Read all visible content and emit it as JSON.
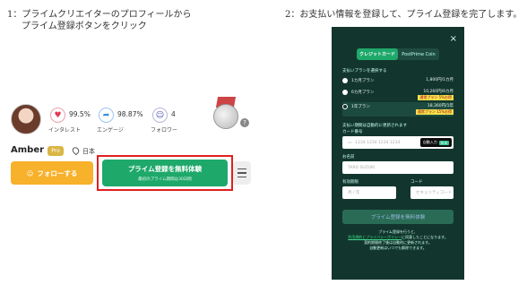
{
  "captions": {
    "step1_line1": "1：プライムクリエイターのプロフィールから",
    "step1_line2": "プライム登録ボタンをクリック",
    "step2": "2：お支払い情報を登録して、プライム登録を完了します。"
  },
  "profile": {
    "name": "Amber",
    "plan_badge": "Pro",
    "country": "日本",
    "stats": [
      {
        "icon": "heart-icon",
        "value": "99.5%",
        "label": "インタレスト"
      },
      {
        "icon": "share-icon",
        "value": "98.87%",
        "label": "エンゲージ"
      },
      {
        "icon": "user-icon",
        "value": "4",
        "label": "フォロワー"
      }
    ],
    "follow_label": "フォローする",
    "prime_button": {
      "main": "プライム登録を無料体験",
      "sub": "最初のプライム期間は30日間"
    },
    "help": "?"
  },
  "payment": {
    "close": "×",
    "tabs": [
      "クレジットカード",
      "PostPrime Coin"
    ],
    "plan_section_label": "支払いプランを選択する",
    "plans": [
      {
        "name": "1カ月プラン",
        "price": "1,800円/1カ月",
        "discount": ""
      },
      {
        "name": "6カ月プラン",
        "price": "10,260円/6カ月",
        "discount": "通常プラン 5%お得"
      },
      {
        "name": "1年プラン",
        "price": "18,360円/1年",
        "discount": "通常プラン 15%お得"
      }
    ],
    "card_note": "支払い期間は自動的に更新されます",
    "card_number_label": "カード番号",
    "card_number_placeholder": "1234 1234 1234 1234",
    "auto_input_label": "自動入力",
    "link_label": "link",
    "name_label": "お名前",
    "name_placeholder": "TARO SUZUKI",
    "expiry_label": "有効期限",
    "code_label": "コード",
    "expiry_placeholder": "月 / 年",
    "code_placeholder": "セキュリティコード",
    "submit_label": "プライム登録を無料体験",
    "notes_line1": "プライム登録を行うと、",
    "notes_link": "利用規約とプライバシーポリシー",
    "notes_line2": "に同意したことになります。",
    "notes_line3": "契約期間終了後は自動的に更新されます。",
    "notes_line4": "自動更新はいつでも解除できます。"
  }
}
